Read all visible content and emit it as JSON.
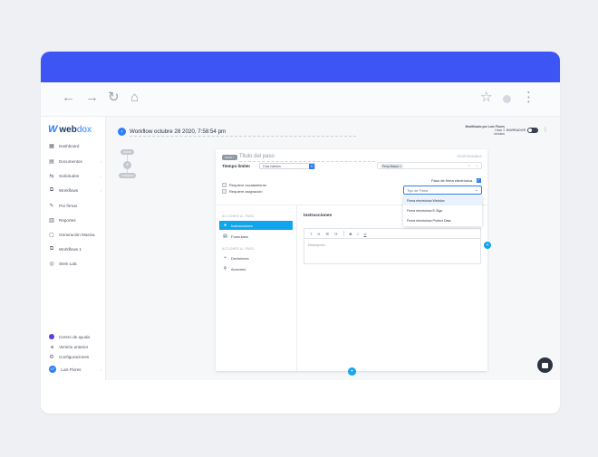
{
  "sidebar": {
    "logo_text": "webdox",
    "logo_highlight": "dox",
    "items": [
      {
        "label": "Dashboard",
        "icon": "dashboard-icon",
        "glyph": "▦"
      },
      {
        "label": "Documentos",
        "icon": "documents-icon",
        "glyph": "▤",
        "chevron": "›"
      },
      {
        "label": "Solicitudes",
        "icon": "requests-icon",
        "glyph": "⇆",
        "chevron": "›"
      },
      {
        "label": "Workflows",
        "icon": "workflows-icon",
        "glyph": "⧉",
        "chevron": "›"
      },
      {
        "label": "Por firmar",
        "icon": "pen-icon",
        "glyph": "✎"
      },
      {
        "label": "Reportes",
        "icon": "reports-icon",
        "glyph": "▥"
      },
      {
        "label": "Generación Masiva",
        "icon": "bulk-icon",
        "glyph": "▢"
      },
      {
        "label": "Workflows 1",
        "icon": "workflows-alt-icon",
        "glyph": "⧉"
      },
      {
        "label": "Stein Lab.",
        "icon": "lab-icon",
        "glyph": "◎"
      }
    ],
    "footer": [
      {
        "label": "Centro de ayuda",
        "icon": "help-icon",
        "color": "#5b3fd9"
      },
      {
        "label": "Versión anterior",
        "icon": "previous-version-icon",
        "glyph": "◂"
      },
      {
        "label": "Configuraciones",
        "icon": "settings-icon",
        "glyph": "⚙"
      },
      {
        "label": "Luis Flores",
        "icon": "avatar",
        "initials": "LF",
        "chevron": "›"
      }
    ]
  },
  "header": {
    "title": "Workflow octubre 28 2020, 7:58:54 pm",
    "modified_by_label": "Modificado por",
    "modified_by_name": "Luis Flores",
    "modified_when": "Hace 3",
    "modified_when_unit": "minutos",
    "draft_label": "BORRADOR",
    "kebab": "⋮"
  },
  "flow": {
    "start_label": "INICIO",
    "end_label": "TERMINO",
    "plus": "+"
  },
  "step": {
    "badge": "PASO 1",
    "title_placeholder": "Titulo del paso",
    "responsable_label": "RESPONSABLE",
    "time_limit_label": "Tiempo límite:",
    "time_limit_value": "0",
    "days_option": "Días hábiles",
    "responsable_chip": "Perry Mason",
    "chip_close": "×",
    "clear": "×",
    "checkboxes": [
      {
        "label": "Requiere escalamiento"
      },
      {
        "label": "Requiere asignación"
      }
    ],
    "signature_label": "Paso de firma electrónica",
    "signature_select_placeholder": "Tipo de Firma",
    "signature_options": [
      "Firma electrónica Webdox",
      "Firma electrónica E-Sign",
      "Firma electrónica Protect Data"
    ],
    "left_sections": [
      {
        "label": "ACCIONES AL PASO",
        "items": [
          {
            "label": "Instrucciones",
            "icon": "instructions-icon",
            "glyph": "●",
            "active": true
          },
          {
            "label": "Formulario",
            "icon": "form-icon",
            "glyph": "▤",
            "active": false
          }
        ]
      },
      {
        "label": "ACCIONES AL PASO",
        "items": [
          {
            "label": "Decisiones",
            "icon": "decisions-icon",
            "glyph": "⑂",
            "active": false
          },
          {
            "label": "Acciones",
            "icon": "actions-icon",
            "glyph": "⚲",
            "active": false
          }
        ]
      }
    ],
    "instructions_title": "Instrucciones",
    "editor_toolbar": [
      "T",
      "H",
      "☰",
      "☷",
      "B",
      "I",
      "U"
    ],
    "description_placeholder": "Descripción"
  },
  "colors": {
    "brand_band": "#3d55f5",
    "accent": "#2d7ff9",
    "active_item": "#11a5ee"
  }
}
